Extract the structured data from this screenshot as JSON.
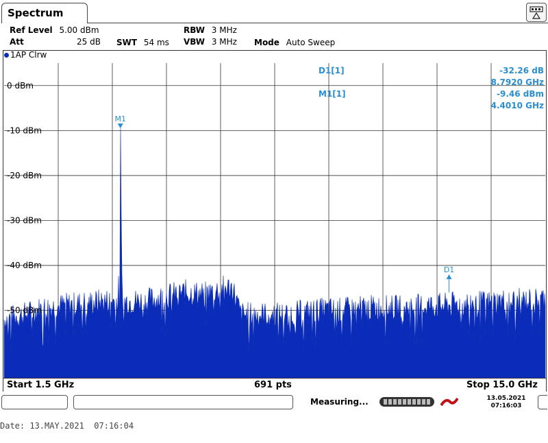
{
  "window": {
    "title": "Spectrum"
  },
  "settings": {
    "ref_level_label": "Ref Level",
    "ref_level_value": "5.00 dBm",
    "att_label": "Att",
    "att_value": "25 dB",
    "swt_label": "SWT",
    "swt_value": "54 ms",
    "rbw_label": "RBW",
    "rbw_value": "3 MHz",
    "vbw_label": "VBW",
    "vbw_value": "3 MHz",
    "mode_label": "Mode",
    "mode_value": "Auto Sweep"
  },
  "trace": {
    "label": "1AP Clrw"
  },
  "markers": {
    "d1_label": "D1[1]",
    "d1_level": "-32.26 dB",
    "d1_freq": "8.7920 GHz",
    "m1_label": "M1[1]",
    "m1_level": "-9.46 dBm",
    "m1_freq": "4.4010 GHz",
    "m1_tag": "M1",
    "d1_tag": "D1"
  },
  "footer": {
    "start": "Start 1.5 GHz",
    "pts": "691 pts",
    "stop": "Stop 15.0 GHz"
  },
  "status": {
    "text": "Measuring...",
    "date": "13.05.2021",
    "time": "07:16:03"
  },
  "date_line": "Date: 13.MAY.2021  07:16:04",
  "colors": {
    "trace": "#0b2cb8",
    "marker_text": "#2a8fd0"
  },
  "chart_data": {
    "type": "area",
    "xlabel": "",
    "ylabel": "",
    "xlim": [
      1.5,
      15.0
    ],
    "ylim": [
      -65,
      5
    ],
    "y_ticks": [
      0,
      -10,
      -20,
      -30,
      -40,
      -50
    ],
    "y_tick_labels": [
      "0 dBm",
      "-10 dBm",
      "-20 dBm",
      "-30 dBm",
      "-40 dBm",
      "-50 dBm"
    ],
    "grid": true,
    "series": [
      {
        "x": [
          1.5,
          2.0,
          2.5,
          3.0,
          3.5,
          4.0,
          4.35,
          4.401,
          4.45,
          5.0,
          5.5,
          6.0,
          6.5,
          7.0,
          7.2,
          7.4,
          8.0,
          8.5,
          9.0,
          9.5,
          10.0,
          10.5,
          11.0,
          11.5,
          12.0,
          12.5,
          13.0,
          13.5,
          14.0,
          14.5,
          15.0
        ],
        "values": [
          -52,
          -51,
          -49.5,
          -49,
          -48.5,
          -48,
          -48,
          -9.5,
          -48,
          -48,
          -47,
          -46,
          -46.5,
          -45,
          -45,
          -51,
          -51,
          -51,
          -50.5,
          -50,
          -50,
          -49.5,
          -49.5,
          -49.5,
          -49,
          -49,
          -48.5,
          -48.5,
          -48,
          -48,
          -47.5
        ]
      }
    ]
  }
}
